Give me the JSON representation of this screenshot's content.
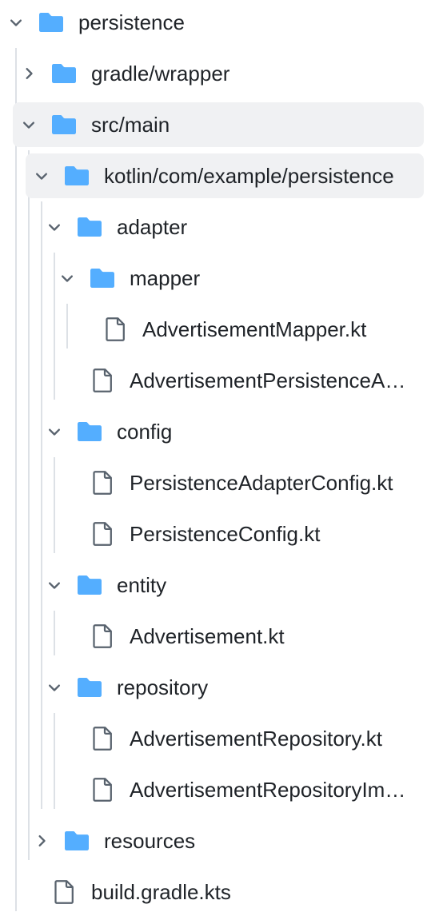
{
  "tree": [
    {
      "label": "persistence",
      "type": "folder",
      "expanded": true,
      "depth": 0
    },
    {
      "label": "gradle/wrapper",
      "type": "folder",
      "expanded": false,
      "depth": 1
    },
    {
      "label": "src/main",
      "type": "folder",
      "expanded": true,
      "depth": 1
    },
    {
      "label": "kotlin/com/example/persistence",
      "type": "folder",
      "expanded": true,
      "depth": 2
    },
    {
      "label": "adapter",
      "type": "folder",
      "expanded": true,
      "depth": 3
    },
    {
      "label": "mapper",
      "type": "folder",
      "expanded": true,
      "depth": 4
    },
    {
      "label": "AdvertisementMapper.kt",
      "type": "file",
      "depth": 5
    },
    {
      "label": "AdvertisementPersistenceAdapter.kt",
      "type": "file",
      "depth": 4
    },
    {
      "label": "config",
      "type": "folder",
      "expanded": true,
      "depth": 3
    },
    {
      "label": "PersistenceAdapterConfig.kt",
      "type": "file",
      "depth": 4
    },
    {
      "label": "PersistenceConfig.kt",
      "type": "file",
      "depth": 4
    },
    {
      "label": "entity",
      "type": "folder",
      "expanded": true,
      "depth": 3
    },
    {
      "label": "Advertisement.kt",
      "type": "file",
      "depth": 4
    },
    {
      "label": "repository",
      "type": "folder",
      "expanded": true,
      "depth": 3
    },
    {
      "label": "AdvertisementRepository.kt",
      "type": "file",
      "depth": 4
    },
    {
      "label": "AdvertisementRepositoryImpl.kt",
      "type": "file",
      "depth": 4
    },
    {
      "label": "resources",
      "type": "folder",
      "expanded": false,
      "depth": 2
    },
    {
      "label": "build.gradle.kts",
      "type": "file",
      "depth": 1
    }
  ],
  "selected_rows": [
    2,
    3
  ],
  "colors": {
    "folder": "#54aeff",
    "file_stroke": "#59636e",
    "chevron": "#59636e",
    "text": "#1f2328",
    "guide": "#dde1e6",
    "selected_bg": "#f0f1f3"
  },
  "icons": {
    "folder": "folder-icon",
    "file": "file-icon",
    "expanded": "chevron-down-icon",
    "collapsed": "chevron-right-icon"
  }
}
